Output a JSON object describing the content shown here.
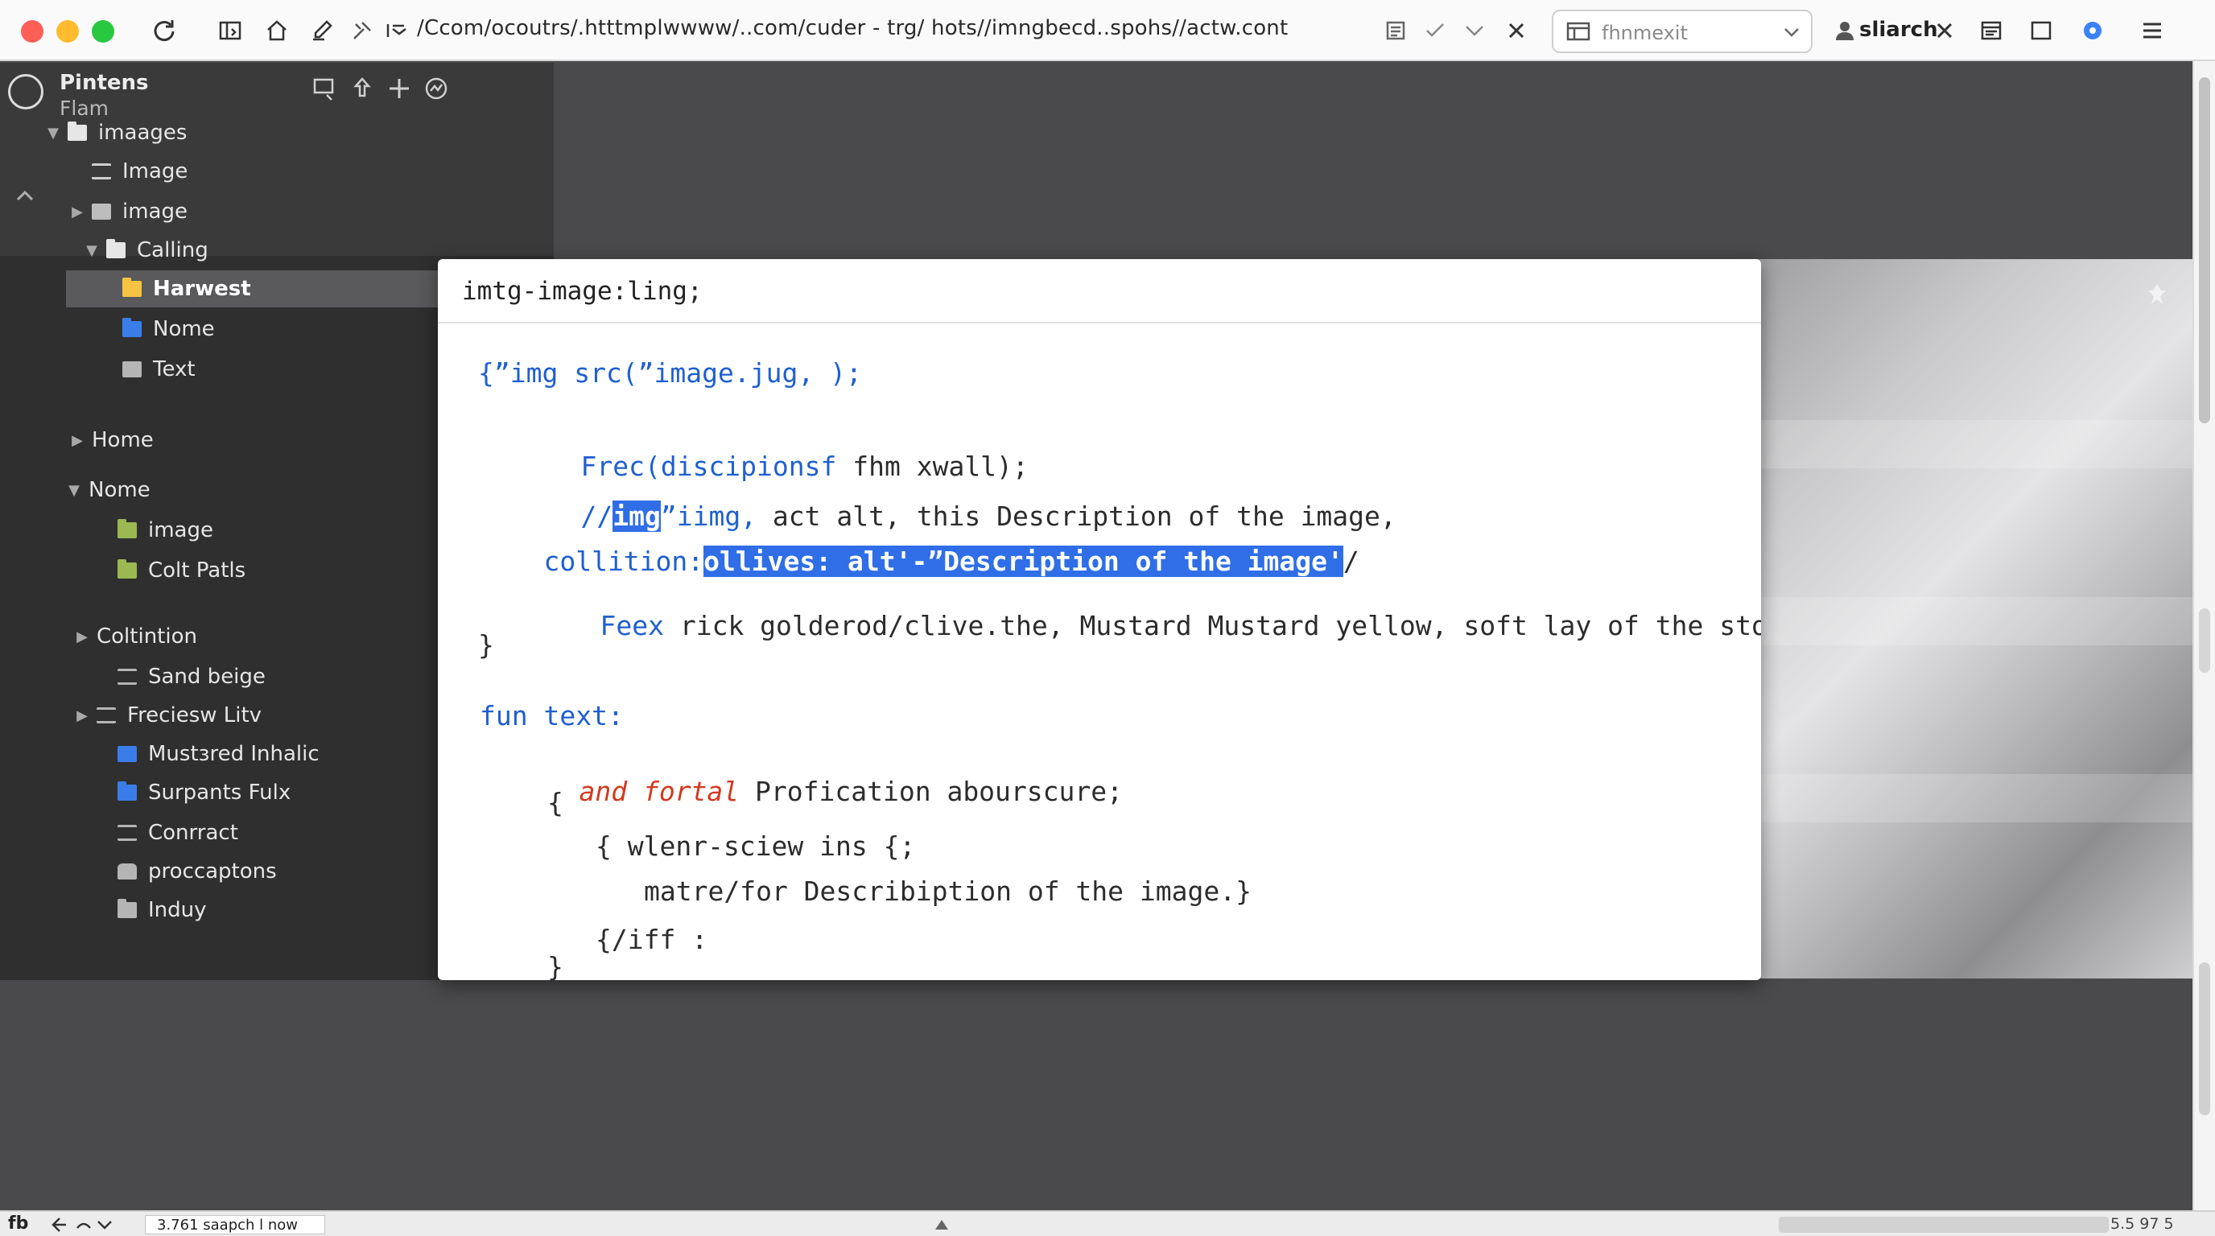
{
  "toolbar": {
    "url": "/Ccom/ocoutrs/.htttmplwwww/..com/cuder - trg/ hots//imngbecd..spohs//actw.cont",
    "search_placeholder": "fhnmexit",
    "user_label": "sliarch",
    "colors": {
      "close": "#ff5f57",
      "minimize": "#febc2e",
      "zoom": "#28c840",
      "accent": "#3b82f6"
    }
  },
  "sidebar": {
    "title": "Pintens",
    "subtitle": "Flam",
    "items": [
      {
        "label": "imaages",
        "icon": "folder-icon",
        "color": "#e6e6e6",
        "expanded": true
      },
      {
        "label": "Image",
        "icon": "list-icon",
        "color": "#d0d0d0",
        "expanded": true
      },
      {
        "label": "image",
        "icon": "image-icon",
        "color": "#bdbdbd",
        "expanded": false
      },
      {
        "label": "Calling",
        "icon": "folder-icon",
        "color": "#e6e6e6",
        "expanded": true
      },
      {
        "label": "Harwest",
        "icon": "folder-icon",
        "color": "#f5c242",
        "selected": true
      },
      {
        "label": "Nome",
        "icon": "folder-icon",
        "color": "#3b7de8"
      },
      {
        "label": "Text",
        "icon": "trash-icon",
        "color": "#b5b5b5"
      },
      {
        "label": "Home",
        "icon": "none",
        "color": "#e6e6e6",
        "expanded": false
      },
      {
        "label": "Nome",
        "icon": "none",
        "color": "#e6e6e6",
        "expanded": true
      },
      {
        "label": "image",
        "icon": "folder-icon",
        "color": "#9bb851"
      },
      {
        "label": "Colt Patls",
        "icon": "folder-icon",
        "color": "#9bb851"
      },
      {
        "label": "Coltintion",
        "icon": "none",
        "color": "#e6e6e6",
        "expanded": false
      },
      {
        "label": "Sand beige",
        "icon": "columns-icon",
        "color": "#b5b5b5"
      },
      {
        "label": "Freciesw Litv",
        "icon": "list-icon",
        "color": "#b5b5b5",
        "expanded": false
      },
      {
        "label": "Mustɜred Inhalic",
        "icon": "square-icon",
        "color": "#3b7de8"
      },
      {
        "label": "Surpants Fulx",
        "icon": "folder-icon",
        "color": "#3b7de8"
      },
      {
        "label": "Conrract",
        "icon": "contract-icon",
        "color": "#b5b5b5"
      },
      {
        "label": "proccaptons",
        "icon": "lock-icon",
        "color": "#b5b5b5"
      },
      {
        "label": "Induy",
        "icon": "folder-icon",
        "color": "#b5b5b5"
      }
    ]
  },
  "popup": {
    "title": "imtg-image:ling;",
    "lines": {
      "l1": "{”img src(”image.jug, );",
      "l2_a": "Frec(",
      "l2_b": "discipionsf",
      "l2_c": " fhm xwall);",
      "l3_a": "//",
      "l3_hl": "img",
      "l3_b": "”iimg,",
      "l3_c": " act alt, this Description of the image,",
      "l4_a": "collition:",
      "l4_hl": "ollives: alt'-”Description of the image'",
      "l4_b": "/",
      "l5_a": "Feex",
      "l5_b": " rick golderod/clive.the, Mustard Mustard yellow, soft lay of the store)",
      "l6": "}",
      "l7": "fun text:",
      "l8_a": "and fortal",
      "l8_b": " Profication abourscure;",
      "l9": "{",
      "l10": "{ wlenr-sciew ins {;",
      "l11": "matre/for Describiption of the image.}",
      "l12": "{/iff :",
      "l13": "}"
    }
  },
  "status": {
    "left": "fb",
    "field_text": "3.761 saapch l now",
    "right": "5.5 97 5"
  }
}
